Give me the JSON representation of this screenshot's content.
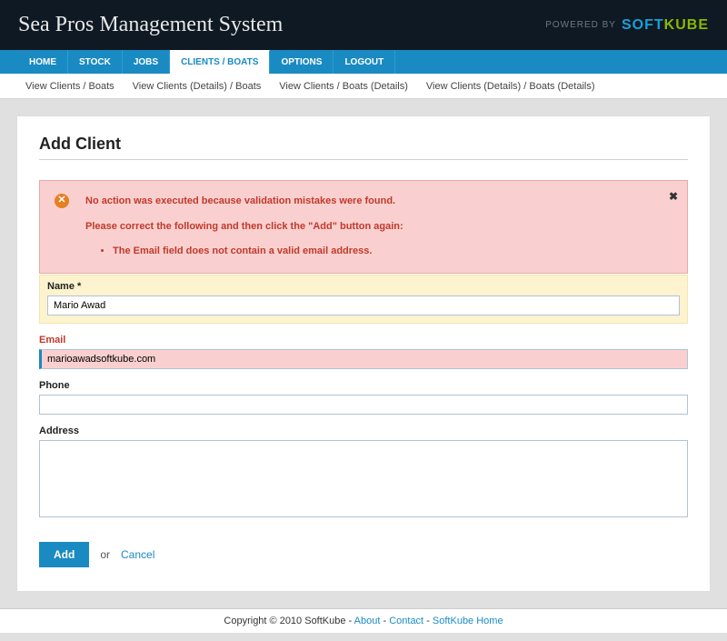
{
  "header": {
    "title": "Sea Pros Management System",
    "powered_label": "POWERED BY",
    "logo_soft": "SOFT",
    "logo_kube": "KUBE"
  },
  "nav": {
    "items": [
      {
        "label": "HOME",
        "active": false
      },
      {
        "label": "STOCK",
        "active": false
      },
      {
        "label": "JOBS",
        "active": false
      },
      {
        "label": "CLIENTS / BOATS",
        "active": true
      },
      {
        "label": "OPTIONS",
        "active": false
      },
      {
        "label": "LOGOUT",
        "active": false
      }
    ]
  },
  "subnav": {
    "items": [
      "View Clients / Boats",
      "View Clients (Details) / Boats",
      "View Clients / Boats (Details)",
      "View Clients (Details) / Boats (Details)"
    ]
  },
  "page": {
    "title": "Add Client"
  },
  "alert": {
    "line1": "No action was executed because validation mistakes were found.",
    "line2": "Please correct the following and then click the \"Add\" button again:",
    "errors": [
      "The Email field does not contain a valid email address."
    ]
  },
  "form": {
    "name": {
      "label": "Name *",
      "value": "Mario Awad"
    },
    "email": {
      "label": "Email",
      "value": "marioawadsoftkube.com"
    },
    "phone": {
      "label": "Phone",
      "value": ""
    },
    "address": {
      "label": "Address",
      "value": ""
    }
  },
  "actions": {
    "submit": "Add",
    "or": "or",
    "cancel": "Cancel"
  },
  "footer": {
    "copyright": "Copyright © 2010 SoftKube - ",
    "about": "About",
    "contact": "Contact",
    "home": "SoftKube Home",
    "sep": " - "
  }
}
